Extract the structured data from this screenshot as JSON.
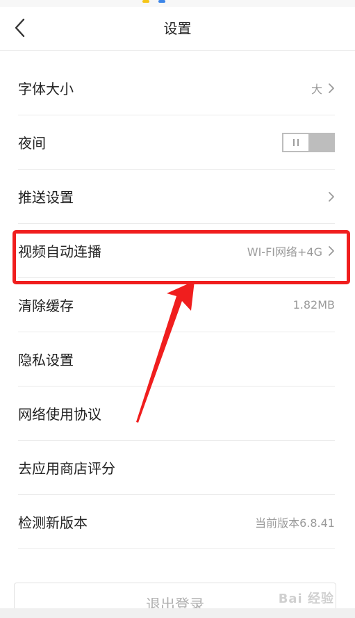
{
  "header": {
    "title": "设置"
  },
  "settings": [
    {
      "label": "字体大小",
      "value": "大",
      "chevron": true,
      "toggle": false
    },
    {
      "label": "夜间",
      "value": "",
      "chevron": false,
      "toggle": true,
      "toggle_on": false
    },
    {
      "label": "推送设置",
      "value": "",
      "chevron": true,
      "toggle": false
    },
    {
      "label": "视频自动连播",
      "value": "WI-FI网络+4G",
      "chevron": true,
      "toggle": false,
      "highlighted": true
    },
    {
      "label": "清除缓存",
      "value": "1.82MB",
      "chevron": false,
      "toggle": false
    },
    {
      "label": "隐私设置",
      "value": "",
      "chevron": false,
      "toggle": false
    },
    {
      "label": "网络使用协议",
      "value": "",
      "chevron": false,
      "toggle": false
    },
    {
      "label": "去应用商店评分",
      "value": "",
      "chevron": false,
      "toggle": false
    },
    {
      "label": "检测新版本",
      "value": "当前版本6.8.41",
      "chevron": false,
      "toggle": false
    }
  ],
  "logout": {
    "label": "退出登录"
  },
  "watermark": {
    "text": "Bai 经验"
  },
  "colors": {
    "highlight": "#f01e1e",
    "arrow": "#f01e1e",
    "value_text": "#9a9a9a",
    "divider": "#ebebeb"
  }
}
